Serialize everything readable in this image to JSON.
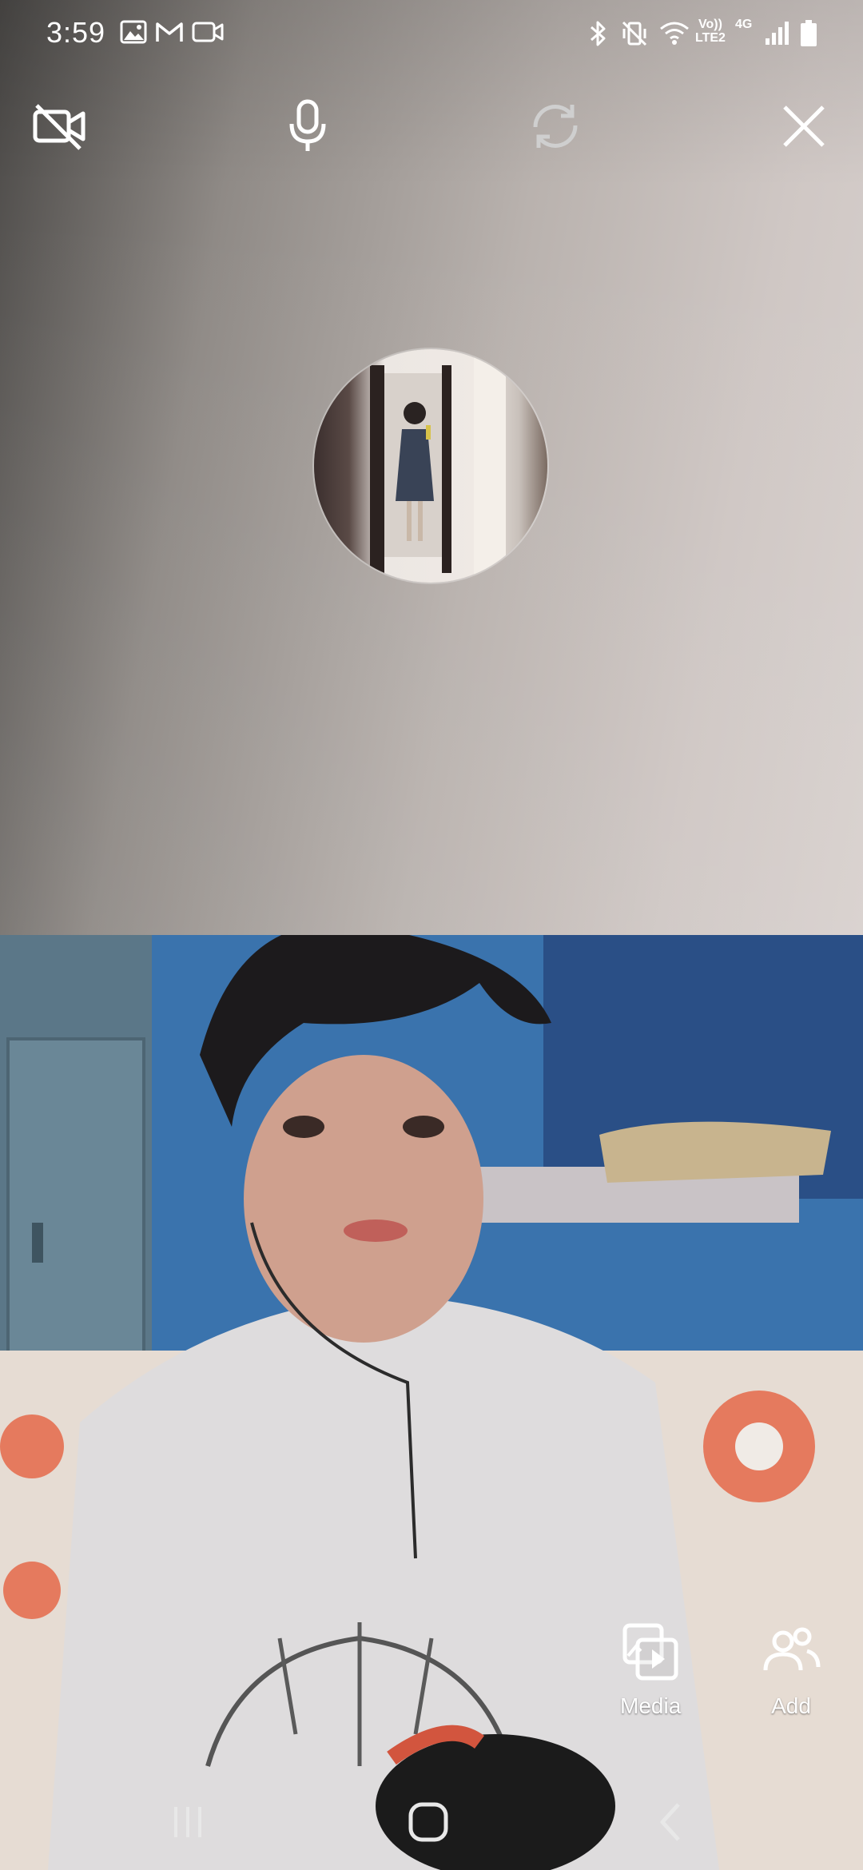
{
  "status_bar": {
    "time": "3:59",
    "network_label_top": "Vo))",
    "network_label_bottom": "LTE2",
    "network_type": "4G",
    "icons": [
      "gallery-icon",
      "gmail-icon",
      "video-icon",
      "bluetooth-icon",
      "vibrate-icon",
      "wifi-icon",
      "signal-icon",
      "battery-icon"
    ]
  },
  "call_controls": {
    "camera_toggle_icon": "video-off-icon",
    "mic_icon": "microphone-icon",
    "flip_icon": "camera-flip-icon",
    "close_icon": "close-icon"
  },
  "actions": {
    "media_label": "Media",
    "add_label": "Add"
  },
  "colors": {
    "accent": "#ffffff",
    "disabled_icon": "#cfcfcf"
  }
}
